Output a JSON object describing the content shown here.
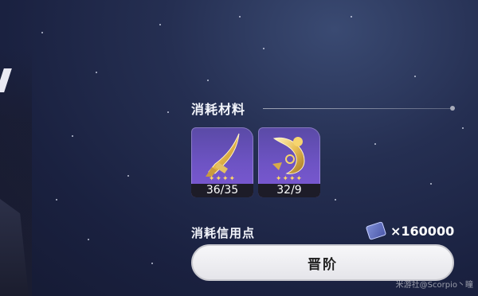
{
  "materials": {
    "title": "消耗材料",
    "items": [
      {
        "name": "golden-blade-material",
        "count": "36/35",
        "rarity_stars": "✦✦✦✦"
      },
      {
        "name": "golden-crescent-material",
        "count": "32/9",
        "rarity_stars": "✦✦✦✦"
      }
    ]
  },
  "credits": {
    "label": "消耗信用点",
    "value": "×160000"
  },
  "action": {
    "ascend_label": "晋阶"
  },
  "watermark": "米游社@Scorpio丶瞳",
  "colors": {
    "item_bg": "#6d53c3",
    "star_color": "#ffd766",
    "button_bg": "#f2f2f5"
  }
}
